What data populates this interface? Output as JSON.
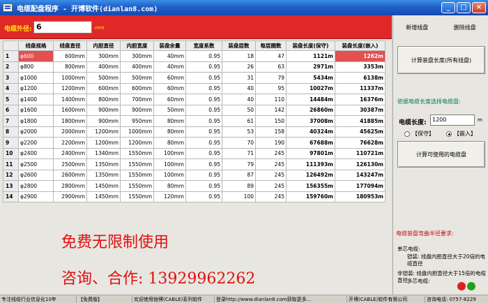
{
  "window": {
    "title": "电缆配盘程序 - 开博软件(dianlan8.com)",
    "minimize": "_",
    "maximize": "□",
    "close": "×"
  },
  "topbar": {
    "outer_label": "电缆外径:",
    "outer_value": "6",
    "outer_unit": "mm"
  },
  "grid": {
    "columns": [
      "",
      "线盘规格",
      "线盘直径",
      "内胆直径",
      "内胆宽度",
      "装盘余量",
      "宽度系数",
      "装盘层数",
      "每层圈数",
      "装盘长度(保守)",
      "装盘长度(嵌入)"
    ],
    "rows": [
      {
        "n": "1",
        "spec": "φ600",
        "d": "600mm",
        "inner": "300mm",
        "width": "300mm",
        "margin": "40mm",
        "coef": "0.95",
        "layers": "18",
        "turns": "47",
        "keep": "1121m",
        "embed": "1262m"
      },
      {
        "n": "2",
        "spec": "φ800",
        "d": "800mm",
        "inner": "400mm",
        "width": "400mm",
        "margin": "40mm",
        "coef": "0.95",
        "layers": "26",
        "turns": "63",
        "keep": "2971m",
        "embed": "3353m"
      },
      {
        "n": "3",
        "spec": "φ1000",
        "d": "1000mm",
        "inner": "500mm",
        "width": "500mm",
        "margin": "60mm",
        "coef": "0.95",
        "layers": "31",
        "turns": "79",
        "keep": "5434m",
        "embed": "6138m"
      },
      {
        "n": "4",
        "spec": "φ1200",
        "d": "1200mm",
        "inner": "600mm",
        "width": "600mm",
        "margin": "60mm",
        "coef": "0.95",
        "layers": "40",
        "turns": "95",
        "keep": "10027m",
        "embed": "11337m"
      },
      {
        "n": "5",
        "spec": "φ1400",
        "d": "1400mm",
        "inner": "800mm",
        "width": "700mm",
        "margin": "60mm",
        "coef": "0.95",
        "layers": "40",
        "turns": "110",
        "keep": "14484m",
        "embed": "16376m"
      },
      {
        "n": "6",
        "spec": "φ1600",
        "d": "1600mm",
        "inner": "900mm",
        "width": "900mm",
        "margin": "50mm",
        "coef": "0.95",
        "layers": "50",
        "turns": "142",
        "keep": "26860m",
        "embed": "30387m"
      },
      {
        "n": "7",
        "spec": "φ1800",
        "d": "1800mm",
        "inner": "900mm",
        "width": "950mm",
        "margin": "80mm",
        "coef": "0.95",
        "layers": "61",
        "turns": "150",
        "keep": "37008m",
        "embed": "41885m"
      },
      {
        "n": "8",
        "spec": "φ2000",
        "d": "2000mm",
        "inner": "1200mm",
        "width": "1000mm",
        "margin": "80mm",
        "coef": "0.95",
        "layers": "53",
        "turns": "158",
        "keep": "40324m",
        "embed": "45625m"
      },
      {
        "n": "9",
        "spec": "φ2200",
        "d": "2200mm",
        "inner": "1200mm",
        "width": "1200mm",
        "margin": "80mm",
        "coef": "0.95",
        "layers": "70",
        "turns": "190",
        "keep": "67688m",
        "embed": "76628m"
      },
      {
        "n": "10",
        "spec": "φ2400",
        "d": "2400mm",
        "inner": "1340mm",
        "width": "1550mm",
        "margin": "100mm",
        "coef": "0.95",
        "layers": "71",
        "turns": "245",
        "keep": "97801m",
        "embed": "110721m"
      },
      {
        "n": "11",
        "spec": "φ2500",
        "d": "2500mm",
        "inner": "1350mm",
        "width": "1550mm",
        "margin": "100mm",
        "coef": "0.95",
        "layers": "79",
        "turns": "245",
        "keep": "111393m",
        "embed": "126130m"
      },
      {
        "n": "12",
        "spec": "φ2600",
        "d": "2600mm",
        "inner": "1350mm",
        "width": "1550mm",
        "margin": "100mm",
        "coef": "0.95",
        "layers": "87",
        "turns": "245",
        "keep": "126492m",
        "embed": "143247m"
      },
      {
        "n": "13",
        "spec": "φ2800",
        "d": "2800mm",
        "inner": "1450mm",
        "width": "1550mm",
        "margin": "80mm",
        "coef": "0.95",
        "layers": "89",
        "turns": "245",
        "keep": "156355m",
        "embed": "177094m"
      },
      {
        "n": "14",
        "spec": "φ2900",
        "d": "2900mm",
        "inner": "1450mm",
        "width": "1550mm",
        "margin": "120mm",
        "coef": "0.95",
        "layers": "100",
        "turns": "245",
        "keep": "159760m",
        "embed": "180953m"
      }
    ]
  },
  "promo": {
    "line1": "免费无限制使用",
    "line2": "咨询、合作: 13929962262"
  },
  "right": {
    "add_reel": "新增线盘",
    "delete_reel": "删除线盘",
    "calc_all": "计算装盘长度(所有线盘)",
    "choose_hint": "依据电缆长度选择电缆盘:",
    "len_label": "电缆长度:",
    "len_value": "1200",
    "len_unit": "m",
    "radio_keep": "【保守】",
    "radio_embed": "【嵌入】",
    "calc_usable": "计算可使用的电缆盘",
    "req_title": "电缆装盘弯曲半径要求:",
    "req1": "单芯电缆:",
    "req2": "铠装: 线盘内胆直径大于20倍的电缆直径",
    "req3": "非铠装: 线盘内胆直径大于15倍的电缆直径",
    "req4": "多芯电缆:",
    "req5": "铠装:"
  },
  "status": {
    "seg1": "专注线缆行业信息化10年",
    "seg2": "【免费版】",
    "seg3": "欢迎使用铠博(CABLE)系列软件",
    "seg4": "登录http://www.dianlan8.com获取更多...",
    "seg5": "开博(CABLE)软件有限公司",
    "seg6": "咨询电话: 0757-8229"
  },
  "colors": {
    "accent_red": "#e02828",
    "label_yellow": "#ffe800",
    "promo_red": "#e01010",
    "hint_green": "#007a5a"
  }
}
